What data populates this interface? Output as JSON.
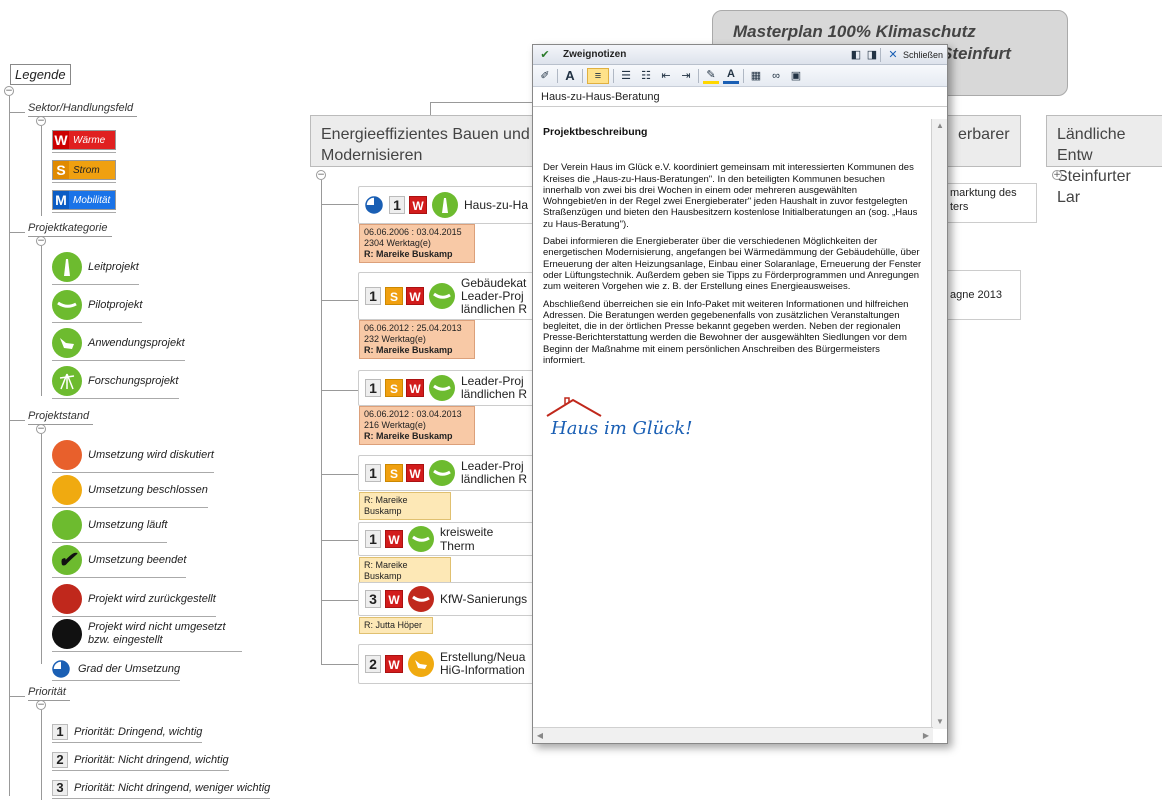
{
  "legend": {
    "title": "Legende",
    "sections": {
      "sector": {
        "label": "Sektor/Handlungsfeld",
        "items": [
          {
            "letter": "W",
            "label": "Wärme",
            "color": "#e02020"
          },
          {
            "letter": "S",
            "label": "Strom",
            "color": "#f0a010"
          },
          {
            "letter": "M",
            "label": "Mobilität",
            "color": "#1a73e8"
          }
        ]
      },
      "category": {
        "label": "Projektkategorie",
        "items": [
          "Leitprojekt",
          "Pilotprojekt",
          "Anwendungsprojekt",
          "Forschungsprojekt"
        ]
      },
      "status": {
        "label": "Projektstand",
        "items": [
          {
            "label": "Umsetzung wird diskutiert",
            "color": "#e8602c"
          },
          {
            "label": "Umsetzung beschlossen",
            "color": "#f0aa10"
          },
          {
            "label": "Umsetzung läuft",
            "color": "#6dbb2f"
          },
          {
            "label": "Umsetzung beendet",
            "color": "#6dbb2f"
          },
          {
            "label": "Projekt wird zurückgestellt",
            "color": "#c0281c"
          },
          {
            "label": "Projekt wird nicht umgesetzt bzw. eingestellt",
            "color": "#111111"
          },
          {
            "label": "Grad der Umsetzung",
            "color": "#1a5fb4"
          }
        ]
      },
      "priority": {
        "label": "Priorität",
        "items": [
          {
            "num": "1",
            "label": "Priorität: Dringend, wichtig"
          },
          {
            "num": "2",
            "label": "Priorität: Nicht dringend, wichtig"
          },
          {
            "num": "3",
            "label": "Priorität: Nicht dringend, weniger wichtig"
          }
        ]
      }
    }
  },
  "map": {
    "master": {
      "line1": "Masterplan 100% Klimaschutz",
      "line2": "Steinfurt"
    },
    "topic_main": {
      "line1": "Energieeffizientes Bauen und",
      "line2": "Modernisieren"
    },
    "topic_right1": "erbarer",
    "topic_right2": {
      "line1": "Ländliche Entw",
      "line2": "Steinfurter Lar"
    },
    "right_nodes": [
      "marktung des",
      "ters",
      "agne 2013"
    ],
    "nodes": [
      {
        "prio": "1",
        "sector": "W",
        "title": "Haus-zu-Ha",
        "info": [
          "06.06.2006 : 03.04.2015",
          "2304 Werktag(e)",
          "R: Mareike Buskamp"
        ]
      },
      {
        "prio": "1",
        "sector": "S",
        "title_lines": [
          "Gebäudekat",
          "Leader-Proj",
          "ländlichen R"
        ],
        "info": [
          "06.06.2012 : 25.04.2013",
          "232 Werktag(e)",
          "R: Mareike Buskamp"
        ]
      },
      {
        "prio": "1",
        "sector": "S",
        "title_lines": [
          "Leader-Proj",
          "ländlichen R"
        ],
        "info": [
          "06.06.2012 : 03.04.2013",
          "216 Werktag(e)",
          "R: Mareike Buskamp"
        ]
      },
      {
        "prio": "1",
        "sector": "S",
        "title_lines": [
          "Leader-Proj",
          "ländlichen R"
        ],
        "info": [
          "R: Mareike Buskamp"
        ]
      },
      {
        "prio": "1",
        "sector": "W",
        "title": "kreisweite Therm",
        "info": [
          "R: Mareike Buskamp"
        ]
      },
      {
        "prio": "3",
        "sector": "W",
        "title": "KfW-Sanierungs",
        "info": [
          "R: Jutta Höper"
        ]
      },
      {
        "prio": "2",
        "sector": "W",
        "title_lines": [
          "Erstellung/Neua",
          "HiG-Information"
        ]
      }
    ]
  },
  "popup": {
    "title": "Zweignotizen",
    "close_label": "Schließen",
    "node_title": "Haus-zu-Haus-Beratung",
    "heading": "Projektbeschreibung",
    "paragraphs": [
      "Der Verein Haus im Glück e.V. koordiniert gemeinsam mit interessierten Kommunen des Kreises die „Haus-zu-Haus-Beratungen\". In den beteiligten Kommunen besuchen innerhalb von zwei bis drei Wochen in einem oder mehreren ausgewählten Wohngebiet/en in der Regel zwei Energieberater\" jeden Haushalt in zuvor festgelegten Straßenzügen und bieten den Hausbesitzern kostenlose Initialberatungen an (sog. „Haus zu Haus-Beratung\").",
      "Dabei informieren die Energieberater über die verschiedenen Möglichkeiten der energetischen Modernisierung, angefangen bei Wärmedämmung der Gebäudehülle, über Erneuerung der alten Heizungsanlage, Einbau einer Solaranlage, Erneuerung der Fenster oder Lüftungstechnik. Außerdem geben sie Tipps zu Förderprogrammen und Anregungen zum weiteren Vorgehen wie z. B. der Erstellung eines Energieausweises.",
      "Abschließend überreichen sie ein Info-Paket mit weiteren Informationen und hilfreichen Adressen. Die Beratungen werden gegebenenfalls von zusätzlichen Veranstaltungen begleitet, die in der örtlichen Presse bekannt gegeben werden. Neben der regionalen Presse-Berichterstattung werden die Bewohner der ausgewählten Siedlungen vor dem Beginn der Maßnahme mit einem persönlichen Anschreiben des Bürgermeisters informiert."
    ],
    "logo_text": "Haus im Glück!"
  }
}
